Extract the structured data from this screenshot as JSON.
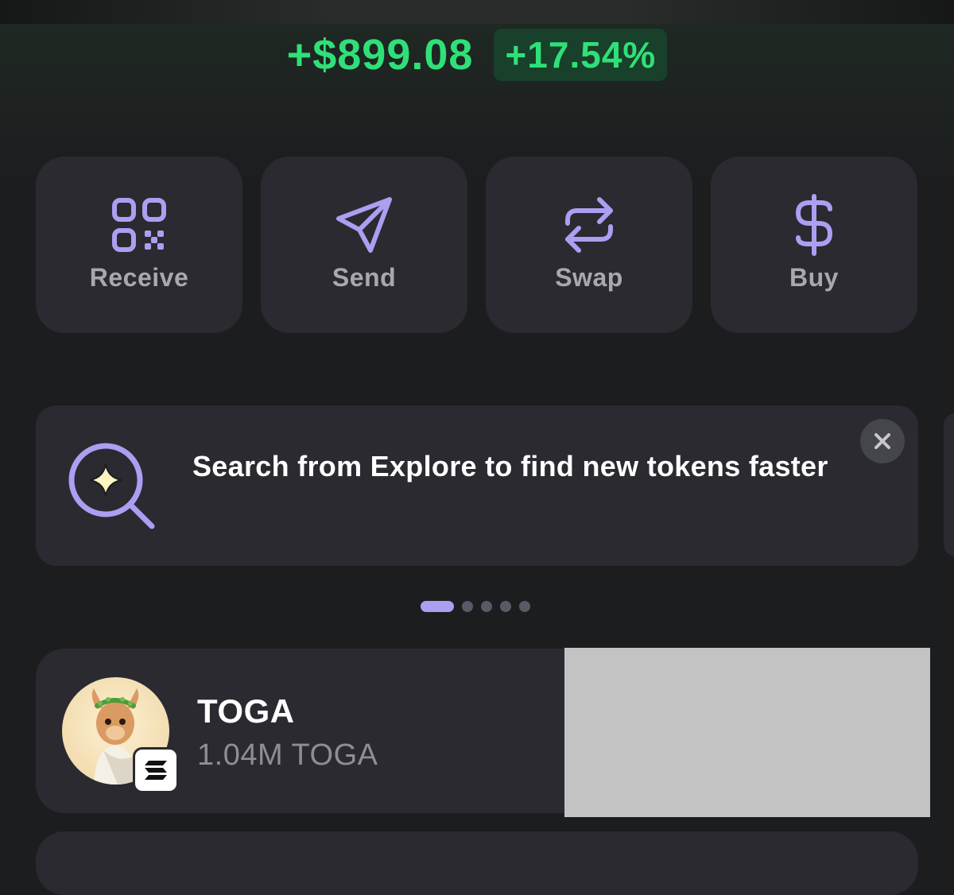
{
  "pnl": {
    "value": "+$899.08",
    "percent": "+17.54%",
    "color": "#2fe078"
  },
  "actions": [
    {
      "label": "Receive",
      "icon": "qr-code-icon"
    },
    {
      "label": "Send",
      "icon": "send-icon"
    },
    {
      "label": "Swap",
      "icon": "swap-icon"
    },
    {
      "label": "Buy",
      "icon": "dollar-icon"
    }
  ],
  "promo": {
    "text": "Search from Explore to find new tokens faster",
    "icon": "search-sparkle-icon",
    "close_icon": "close-icon",
    "accent": "#ab9ff2"
  },
  "carousel": {
    "pages": 5,
    "active": 0
  },
  "tokens": [
    {
      "name": "TOGA",
      "amount": "1.04M TOGA",
      "chain_icon": "solana-icon"
    }
  ]
}
